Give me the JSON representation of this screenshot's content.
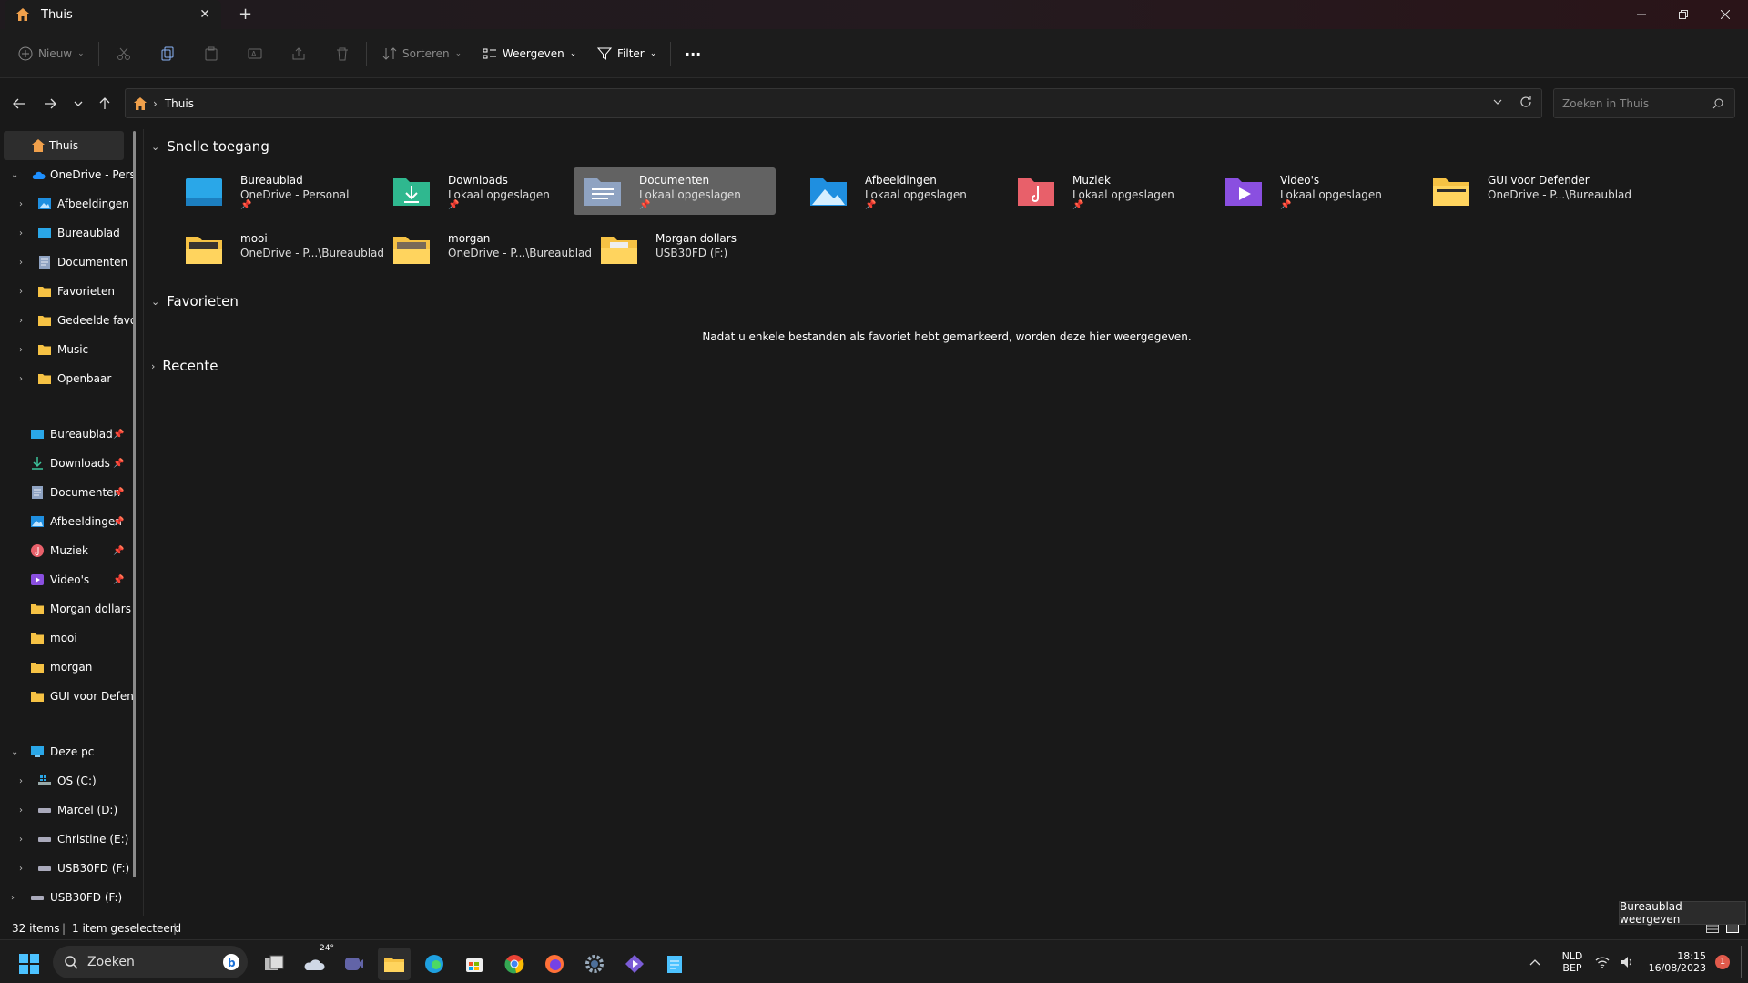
{
  "window": {
    "tab_title": "Thuis",
    "new_tab": "+",
    "close_tab": "✕"
  },
  "toolbar": {
    "new_label": "Nieuw",
    "sort_label": "Sorteren",
    "view_label": "Weergeven",
    "filter_label": "Filter",
    "more_label": "···"
  },
  "address": {
    "crumb": "Thuis",
    "search_placeholder": "Zoeken in Thuis"
  },
  "sidebar": {
    "home": "Thuis",
    "onedrive": "OneDrive - Personal",
    "onedrive_children": [
      "Afbeeldingen",
      "Bureaublad",
      "Documenten",
      "Favorieten",
      "Gedeelde favorieten",
      "Music",
      "Openbaar"
    ],
    "pinned": [
      "Bureaublad",
      "Downloads",
      "Documenten",
      "Afbeeldingen",
      "Muziek",
      "Video's"
    ],
    "recent_folders": [
      "Morgan dollars",
      "mooi",
      "morgan",
      "GUI voor Defender"
    ],
    "this_pc": "Deze pc",
    "drives": [
      "OS (C:)",
      "Marcel (D:)",
      "Christine (E:)",
      "USB30FD (F:)"
    ],
    "usb": "USB30FD (F:)"
  },
  "content": {
    "quick_access_title": "Snelle toegang",
    "favorites_title": "Favorieten",
    "recent_title": "Recente",
    "favorites_empty": "Nadat u enkele bestanden als favoriet hebt gemarkeerd, worden deze hier weergegeven.",
    "quick_access": [
      {
        "name": "Bureaublad",
        "sub": "OneDrive - Personal",
        "pinned": true,
        "icon": "desktop-folder-icon"
      },
      {
        "name": "Downloads",
        "sub": "Lokaal opgeslagen",
        "pinned": true,
        "icon": "downloads-folder-icon"
      },
      {
        "name": "Documenten",
        "sub": "Lokaal opgeslagen",
        "pinned": true,
        "icon": "documents-folder-icon"
      },
      {
        "name": "Afbeeldingen",
        "sub": "Lokaal opgeslagen",
        "pinned": true,
        "icon": "pictures-folder-icon"
      },
      {
        "name": "Muziek",
        "sub": "Lokaal opgeslagen",
        "pinned": true,
        "icon": "music-folder-icon"
      },
      {
        "name": "Video's",
        "sub": "Lokaal opgeslagen",
        "pinned": true,
        "icon": "videos-folder-icon"
      },
      {
        "name": "GUI voor Defender",
        "sub": "OneDrive - P...\\Bureaublad",
        "pinned": false,
        "icon": "folder-icon"
      },
      {
        "name": "mooi",
        "sub": "OneDrive - P...\\Bureaublad",
        "pinned": false,
        "icon": "photo-folder-icon"
      },
      {
        "name": "morgan",
        "sub": "OneDrive - P...\\Bureaublad",
        "pinned": false,
        "icon": "photo-folder-icon"
      },
      {
        "name": "Morgan dollars",
        "sub": "USB30FD (F:)",
        "pinned": false,
        "icon": "folder-icon"
      }
    ]
  },
  "status": {
    "items": "32 items",
    "selected": "1 item geselecteerd",
    "tooltip": "Bureaublad weergeven"
  },
  "taskbar": {
    "search": "Zoeken",
    "weather": "24°",
    "lang_top": "NLD",
    "lang_bottom": "BEP",
    "time": "18:15",
    "date": "16/08/2023",
    "notification_count": "1"
  },
  "colors": {
    "accent": "#4cc2ff",
    "folder_yellow": "#f6c244",
    "selection": "#626262"
  }
}
